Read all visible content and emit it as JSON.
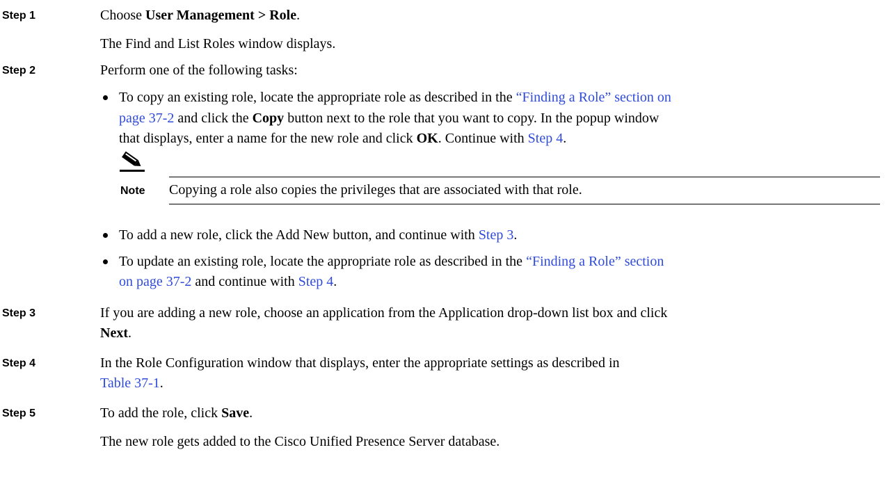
{
  "steps": [
    {
      "label": "Step 1",
      "lines": [
        {
          "pre": "Choose ",
          "bold": "User Management > Role",
          "post": "."
        }
      ],
      "result": "The Find and List Roles window displays."
    },
    {
      "label": "Step 2",
      "intro": "Perform one of the following tasks:",
      "bullets": [
        {
          "line1_pre": "To copy an existing role, locate the appropriate role as described in the ",
          "line1_link": "“Finding a Role” section on",
          "line2_link": "page 37-2",
          "line2_mid": " and click the ",
          "line2_bold": "Copy",
          "line2_post": " button next to the role that you want to copy. In the popup window",
          "line3_pre": "that displays, enter a name for the new role and click ",
          "line3_bold": "OK",
          "line3_mid": ". Continue with ",
          "line3_link": "Step 4",
          "line3_post": "."
        },
        {
          "pre": "To add a new role, click the Add New button, and continue with ",
          "link": "Step 3",
          "post": "."
        },
        {
          "line1_pre": "To update an existing role, locate the appropriate role as described in the ",
          "line1_link": "“Finding a Role” section",
          "line2_link": "on page 37-2",
          "line2_mid": " and continue with ",
          "line2_link2": "Step 4",
          "line2_post": "."
        }
      ],
      "note": {
        "label": "Note",
        "text": "Copying a role also copies the privileges that are associated with that role.",
        "icon": "pencil-icon"
      }
    },
    {
      "label": "Step 3",
      "line1": "If you are adding a new role, choose an application from the Application drop-down list box and click",
      "line2_bold": "Next",
      "line2_post": "."
    },
    {
      "label": "Step 4",
      "line1": "In the Role Configuration window that displays, enter the appropriate settings as described in",
      "line2_link": "Table 37-1",
      "line2_post": "."
    },
    {
      "label": "Step 5",
      "pre": "To add the role, click ",
      "bold": "Save",
      "post": ".",
      "result": "The new role gets added to the Cisco Unified Presence Server database."
    }
  ],
  "colors": {
    "link": "#2f4bd8",
    "text": "#000000",
    "background": "#ffffff"
  }
}
